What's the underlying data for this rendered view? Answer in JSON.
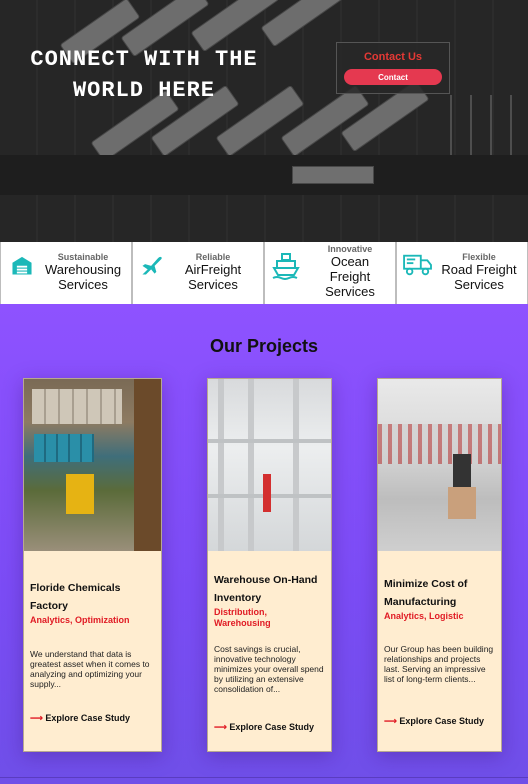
{
  "hero": {
    "title": "CONNECT WITH THE WORLD HERE",
    "contact_heading": "Contact Us",
    "contact_button": "Contact"
  },
  "services": [
    {
      "sub": "Sustainable",
      "name": "Warehousing Services",
      "icon": "warehouse-icon"
    },
    {
      "sub": "Reliable",
      "name": "AirFreight Services",
      "icon": "plane-icon"
    },
    {
      "sub": "Innovative",
      "name": "Ocean Freight Services",
      "icon": "ship-icon"
    },
    {
      "sub": "Flexible",
      "name": "Road Freight Services",
      "icon": "truck-icon"
    }
  ],
  "projects": {
    "title": "Our Projects",
    "items": [
      {
        "title": "Floride Chemicals Factory",
        "tags": "Analytics, Optimization",
        "desc": "We understand that data is greatest asset when it comes to analyzing and optimizing your supply...",
        "cta": "Explore Case Study"
      },
      {
        "title": "Warehouse On-Hand Inventory",
        "tags": "Distribution, Warehousing",
        "desc": "Cost savings is crucial, innovative technology minimizes your overall spend by utilizing an extensive consolidation of...",
        "cta": "Explore Case Study"
      },
      {
        "title": "Minimize Cost of Manufacturing",
        "tags": "Analytics, Logistic",
        "desc": "Our Group has been building relationships and projects last. Serving an impressive list of long-term clients...",
        "cta": "Explore Case Study"
      }
    ]
  },
  "colors": {
    "accent": "#e53950",
    "icon": "#1bb8b8",
    "background": "#8e52ff",
    "card": "#ffedd0"
  }
}
